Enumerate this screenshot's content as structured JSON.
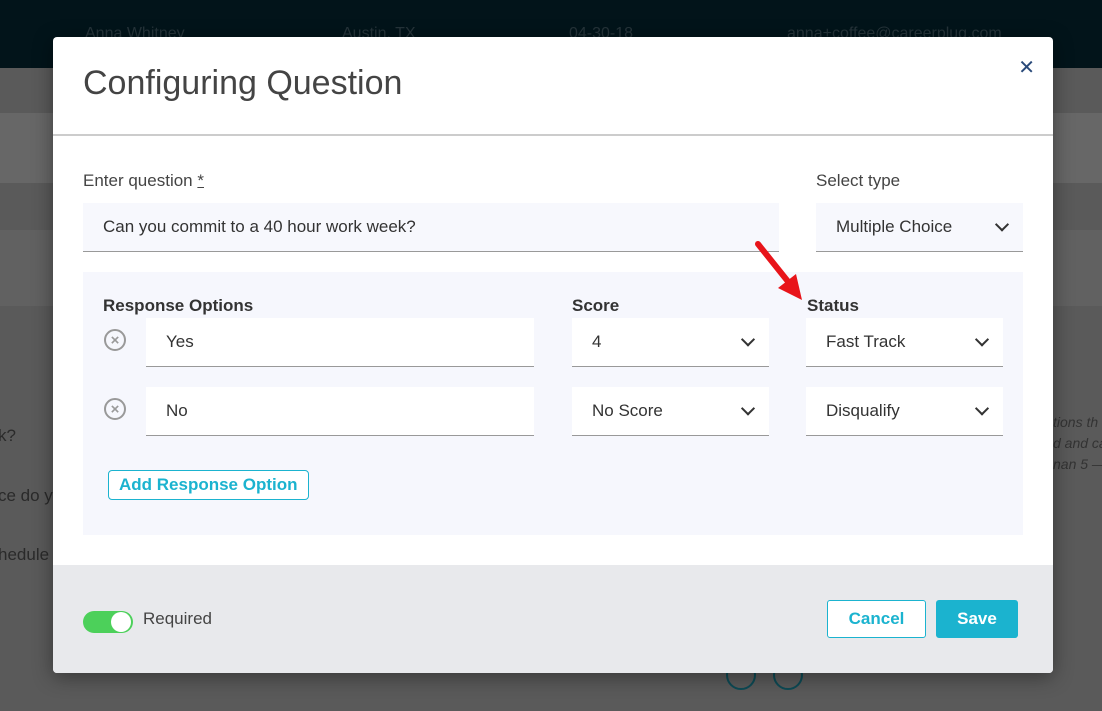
{
  "background": {
    "row": {
      "name": "Anna Whitney",
      "location": "Austin, TX",
      "date": "04-30-18",
      "email": "anna+coffee@careerplug.com"
    },
    "fragments": [
      "k?",
      "ce do yo",
      "hedule ("
    ],
    "italic": [
      "tions th",
      "d and ca",
      "nan 5 —"
    ]
  },
  "modal": {
    "title": "Configuring Question",
    "close_icon": "close-icon",
    "question_label": "Enter question",
    "required_mark": "*",
    "question_value": "Can you commit to a 40 hour work week?",
    "type_label": "Select type",
    "type_value": "Multiple Choice",
    "columns": {
      "options": "Response Options",
      "score": "Score",
      "status": "Status"
    },
    "rows": [
      {
        "option": "Yes",
        "score": "4",
        "status": "Fast Track"
      },
      {
        "option": "No",
        "score": "No Score",
        "status": "Disqualify"
      }
    ],
    "add_label": "Add Response Option",
    "required_label": "Required",
    "required_on": true,
    "cancel_label": "Cancel",
    "save_label": "Save"
  },
  "colors": {
    "accent": "#1bb3cf",
    "toggle": "#4cd05a",
    "annotation_arrow": "#e8141a"
  }
}
